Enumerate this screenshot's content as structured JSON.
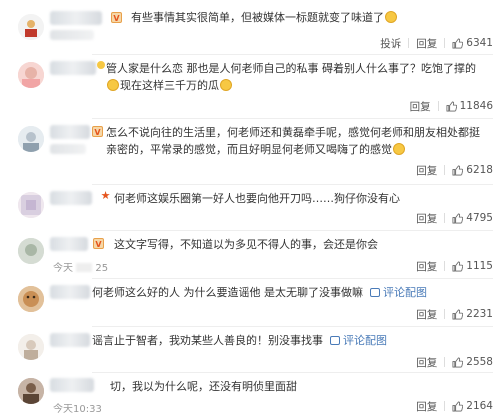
{
  "comments": [
    {
      "text_parts": [
        "有些事情其实很简单，但被媒体一标题就变了味道了",
        ""
      ],
      "emoji_count": 1,
      "actions": [
        "投诉",
        "回复"
      ],
      "likes": "6341"
    },
    {
      "text": "管人家是什么恋 那也是人何老师自己的私事 碍着别人什么事了？吃饱了撑的",
      "text_tail": "现在这样三千万的瓜",
      "actions": [
        "回复"
      ],
      "likes": "11846"
    },
    {
      "text": "怎么不说向往的生活里，何老师还和黄磊牵手呢，感觉何老师和朋友相处都挺亲密的，平常录的感觉，而且好明显何老师又喝嗨了的感觉",
      "actions": [
        "回复"
      ],
      "likes": "6218"
    },
    {
      "text": "何老师这娱乐圈第一好人也要向他开刀吗……狗仔你没有心",
      "actions": [
        "回复"
      ],
      "likes": "4795"
    },
    {
      "text": "这文字写得，不知道以为多见不得人的事，会还是你会",
      "timestamp_fragment": "今天",
      "timestamp_tail": "25",
      "actions": [
        "回复"
      ],
      "likes": "1115"
    },
    {
      "text": "何老师这么好的人 为什么要造谣他 是太无聊了没事做嘛",
      "link": "评论配图",
      "actions": [
        "回复"
      ],
      "likes": "2231"
    },
    {
      "text": "谣言止于智者，我劝某些人善良的！别没事找事",
      "link": "评论配图",
      "actions": [
        "回复"
      ],
      "likes": "2558"
    },
    {
      "text": "切，我以为什么呢，还没有明侦里面甜",
      "timestamp": "今天10:33",
      "actions": [
        "回复"
      ],
      "likes": "2164"
    }
  ],
  "colors": {
    "link": "#4a7bb8",
    "text": "#333333",
    "muted": "#999999",
    "emoji": "#f7c843"
  },
  "icons": {
    "like": "thumbs-up-icon",
    "image_link": "image-icon"
  }
}
